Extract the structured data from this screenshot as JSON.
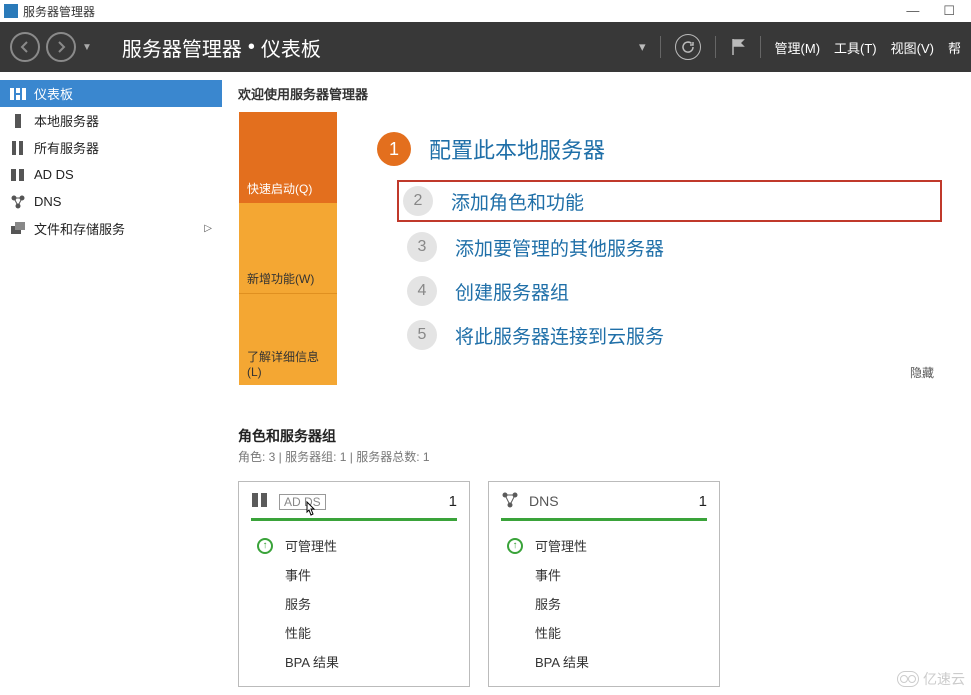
{
  "titlebar": {
    "app_title": "服务器管理器"
  },
  "header": {
    "breadcrumb_root": "服务器管理器",
    "breadcrumb_current": "仪表板",
    "menus": {
      "manage": "管理(M)",
      "tools": "工具(T)",
      "view": "视图(V)",
      "help": "帮"
    }
  },
  "sidebar": {
    "items": [
      {
        "label": "仪表板",
        "icon": "dashboard-icon",
        "selected": true
      },
      {
        "label": "本地服务器",
        "icon": "server-icon"
      },
      {
        "label": "所有服务器",
        "icon": "servers-icon"
      },
      {
        "label": "AD DS",
        "icon": "adds-icon"
      },
      {
        "label": "DNS",
        "icon": "dns-icon"
      },
      {
        "label": "文件和存储服务",
        "icon": "storage-icon",
        "expandable": true
      }
    ]
  },
  "welcome": {
    "title": "欢迎使用服务器管理器",
    "tiles": {
      "quickstart": "快速启动(Q)",
      "whatsnew": "新增功能(W)",
      "learnmore": "了解详细信息(L)"
    },
    "steps": [
      {
        "num": "1",
        "label": "配置此本地服务器",
        "style": "big"
      },
      {
        "num": "2",
        "label": "添加角色和功能",
        "style": "highlight"
      },
      {
        "num": "3",
        "label": "添加要管理的其他服务器",
        "style": "normal"
      },
      {
        "num": "4",
        "label": "创建服务器组",
        "style": "normal"
      },
      {
        "num": "5",
        "label": "将此服务器连接到云服务",
        "style": "normal"
      }
    ],
    "hide": "隐藏"
  },
  "roles": {
    "title": "角色和服务器组",
    "subtitle": "角色: 3 | 服务器组: 1 | 服务器总数: 1",
    "cards": [
      {
        "title": "AD DS",
        "count": "1",
        "rows": {
          "manage": "可管理性",
          "events": "事件",
          "services": "服务",
          "perf": "性能",
          "bpa": "BPA 结果"
        },
        "tooltip": "AD DS"
      },
      {
        "title": "DNS",
        "count": "1",
        "rows": {
          "manage": "可管理性",
          "events": "事件",
          "services": "服务",
          "perf": "性能",
          "bpa": "BPA 结果"
        }
      }
    ]
  },
  "watermark": "亿速云"
}
